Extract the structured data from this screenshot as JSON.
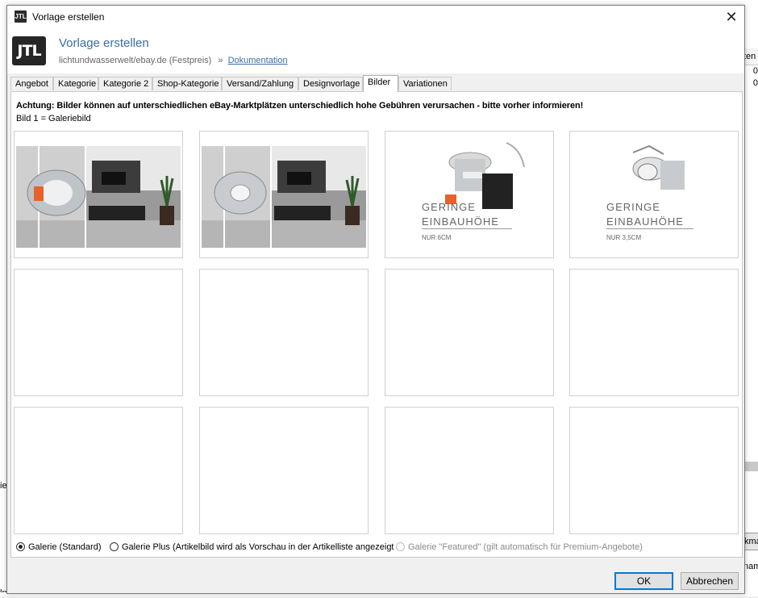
{
  "window": {
    "title": "Vorlage erstellen",
    "close_symbol": "✕",
    "icon_text": "JTL"
  },
  "header": {
    "logo_text": "JTL",
    "title": "Vorlage erstellen",
    "subtitle": "lichtundwasserwelt/ebay.de (Festpreis)",
    "separator": "»",
    "doc_link": "Dokumentation"
  },
  "tabs": [
    {
      "label": "Angebot"
    },
    {
      "label": "Kategorie"
    },
    {
      "label": "Kategorie 2"
    },
    {
      "label": "Shop-Kategorie"
    },
    {
      "label": "Versand/Zahlung"
    },
    {
      "label": "Designvorlage"
    },
    {
      "label": "Bilder",
      "active": true
    },
    {
      "label": "Variationen"
    }
  ],
  "images_tab": {
    "warning": "Achtung: Bilder können auf unterschiedlichen eBay-Marktplätzen unterschiedlich hohe Gebühren verursachen - bitte vorher informieren!",
    "gallery_note": "Bild 1 = Galeriebild",
    "slots": [
      {
        "content": "room-photo"
      },
      {
        "content": "room-photo"
      },
      {
        "content": "product",
        "caption_line1": "GERINGE",
        "caption_line2": "EINBAUHÖHE",
        "caption_small": "NUR 6CM"
      },
      {
        "content": "product",
        "caption_line1": "GERINGE",
        "caption_line2": "EINBAUHÖHE",
        "caption_small": "NUR 3,5CM"
      },
      {
        "content": "empty"
      },
      {
        "content": "empty"
      },
      {
        "content": "empty"
      },
      {
        "content": "empty"
      },
      {
        "content": "empty"
      },
      {
        "content": "empty"
      },
      {
        "content": "empty"
      },
      {
        "content": "empty"
      }
    ],
    "gallery_options": {
      "standard": "Galerie (Standard)",
      "plus": "Galerie Plus (Artikelbild wird als Vorschau in der Artikelliste angezeigt)",
      "featured": "Galerie \"Featured\" (gilt automatisch für Premium-Angebote)",
      "selected": "standard"
    }
  },
  "buttons": {
    "ok": "OK",
    "cancel": "Abbrechen"
  },
  "background": {
    "right_header": "ten",
    "right_cells": [
      "0",
      "0"
    ],
    "right_button": "kma",
    "right_text": "nam",
    "left_text_1": "ie",
    "left_text_2": "lnis"
  },
  "colors": {
    "accent": "#3a6ea5",
    "ok_border": "#0078d7"
  }
}
